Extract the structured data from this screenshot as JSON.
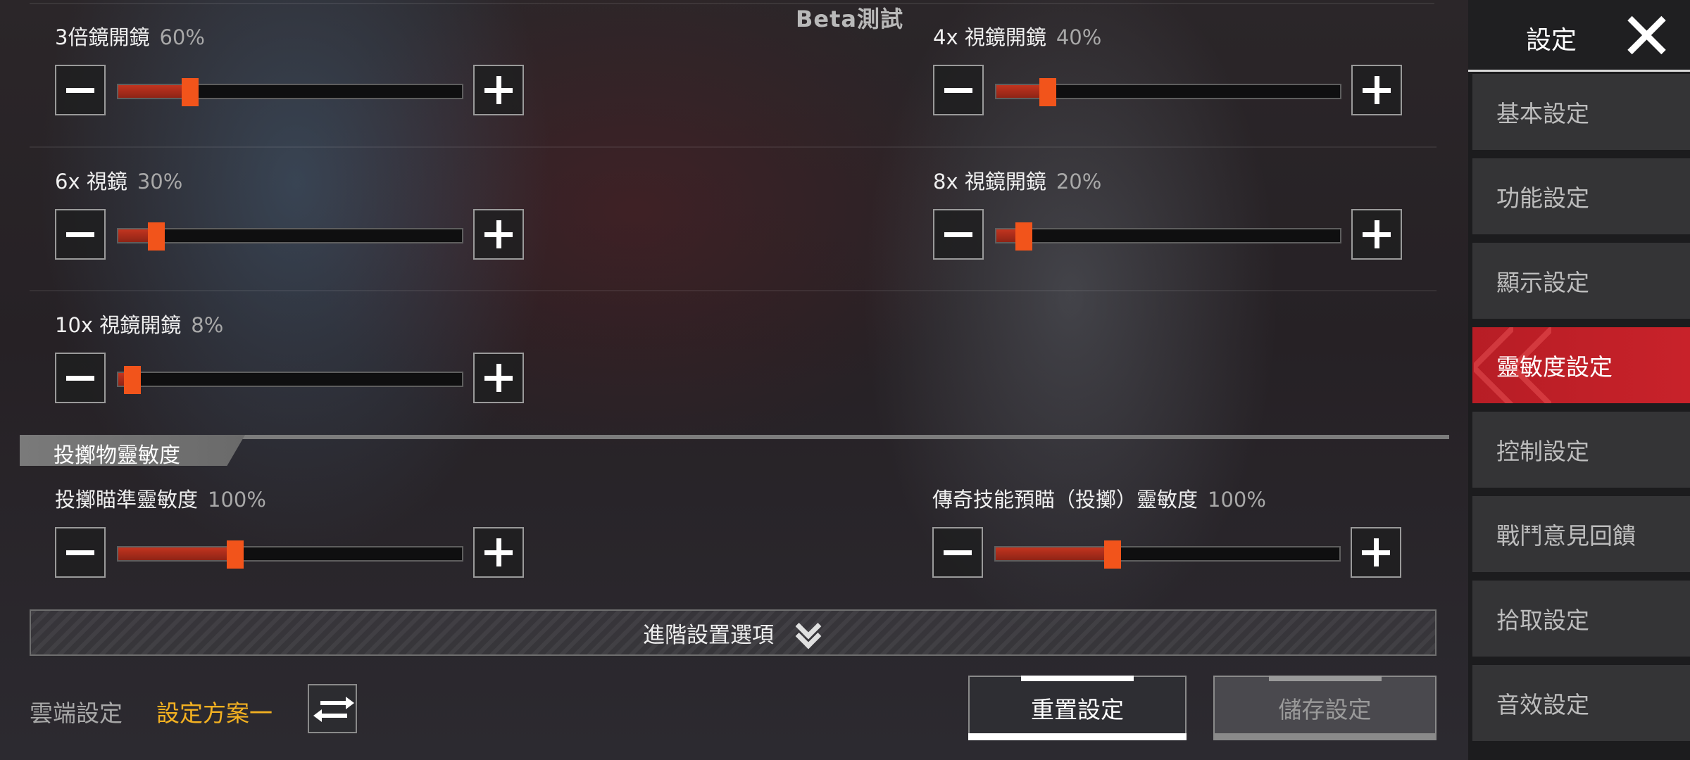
{
  "beta_label": "Beta測試",
  "sliders": [
    {
      "label": "3倍鏡開鏡",
      "percent_label": "60%",
      "value": 0.21
    },
    {
      "label": "4x 視鏡開鏡",
      "percent_label": "40%",
      "value": 0.15
    },
    {
      "label": "6x 視鏡",
      "percent_label": "30%",
      "value": 0.11
    },
    {
      "label": "8x 視鏡開鏡",
      "percent_label": "20%",
      "value": 0.08
    },
    {
      "label": "10x 視鏡開鏡",
      "percent_label": "8%",
      "value": 0.04
    },
    {
      "label": "投擲瞄準靈敏度",
      "percent_label": "100%",
      "value": 0.34
    },
    {
      "label": "傳奇技能預瞄（投擲）靈敏度",
      "percent_label": "100%",
      "value": 0.34
    }
  ],
  "section_throwables": "投擲物靈敏度",
  "advanced_options": "進階設置選項",
  "cloud_label": "雲端設定",
  "scheme_label": "設定方案一",
  "reset_button": "重置設定",
  "save_button": "儲存設定",
  "sidebar": {
    "title": "設定",
    "items": [
      "基本設定",
      "功能設定",
      "顯示設定",
      "靈敏度設定",
      "控制設定",
      "戰鬥意見回饋",
      "拾取設定",
      "音效設定"
    ],
    "active_index": 3
  },
  "colors": {
    "accent_orange": "#f2541b",
    "active_red": "#c8222a",
    "scheme_yellow": "#f4b121"
  }
}
